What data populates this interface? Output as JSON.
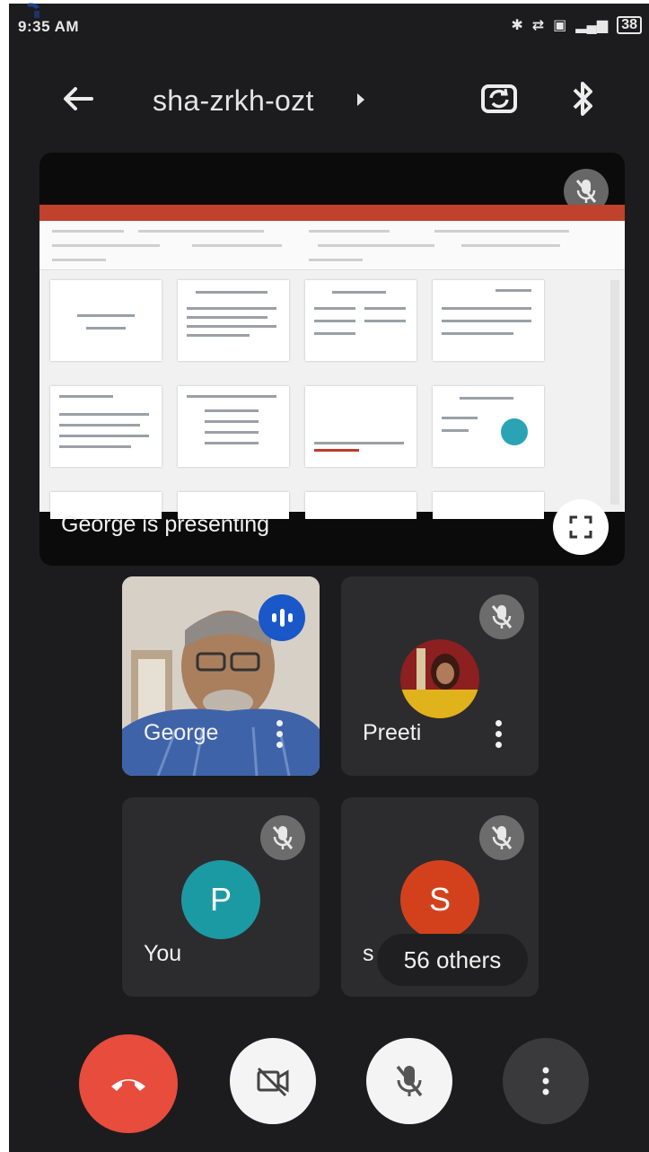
{
  "status_bar": {
    "time": "9:35 AM",
    "battery": "38"
  },
  "header": {
    "meeting_code": "sha-zrkh-ozt",
    "back_icon": "back-arrow-icon",
    "switch_camera_icon": "switch-camera-icon",
    "bluetooth_icon": "bluetooth-icon"
  },
  "presentation": {
    "label": "George is presenting",
    "presenter_muted": true
  },
  "participants": [
    {
      "name": "George",
      "type": "video",
      "speaking": true
    },
    {
      "name": "Preeti",
      "type": "photo",
      "muted": true
    },
    {
      "name": "You",
      "initial": "P",
      "avatar_color": "#1c9aa3",
      "muted": true
    },
    {
      "name": "s",
      "initial": "S",
      "avatar_color": "#d3411c",
      "muted": true
    }
  ],
  "others_label": "56 others",
  "controls": {
    "end_call_color": "#e74c3c",
    "button_color": "#f4f4f4",
    "more_color": "#3a3a3c"
  }
}
